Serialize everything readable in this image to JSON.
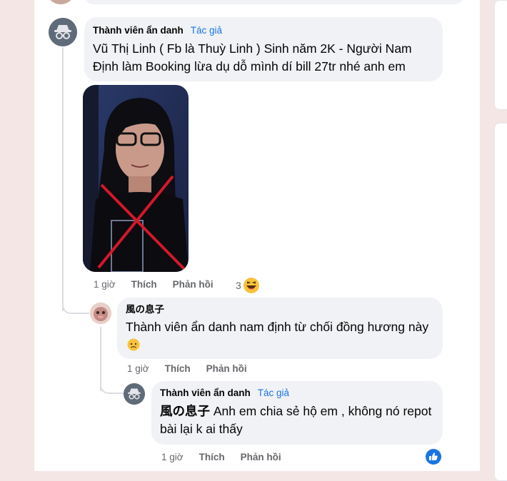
{
  "thread": {
    "comment": {
      "author": "Thành viên ẩn danh",
      "author_badge": "Tác giả",
      "text": "Vũ Thị Linh ( Fb là Thuỳ Linh ) Sinh năm 2K - Người Nam Định làm Booking lừa dụ dỗ mình dí bill 27tr nhé anh em",
      "time": "1 giờ",
      "like_label": "Thích",
      "reply_label": "Phản hồi",
      "reaction_count": "3",
      "reaction_icon": "laughing-emoji"
    },
    "reply1": {
      "author": "風の息子",
      "text": "Thành viên ẩn danh nam định từ chối đồng hương này",
      "emoji": "sad-face-emoji",
      "time": "1 giờ",
      "like_label": "Thích",
      "reply_label": "Phản hồi"
    },
    "reply2": {
      "author": "Thành viên ẩn danh",
      "author_badge": "Tác giả",
      "mention": "風の息子",
      "text": "Anh em chia sẻ hộ em , không nó repot bài lại k ai thấy",
      "time": "1 giờ",
      "like_label": "Thích",
      "reply_label": "Phản hồi",
      "reaction_icon": "like-icon"
    }
  },
  "colors": {
    "link": "#1b74e4",
    "bubble": "#f0f2f5",
    "meta": "#65676b",
    "cross": "#d4182a"
  }
}
